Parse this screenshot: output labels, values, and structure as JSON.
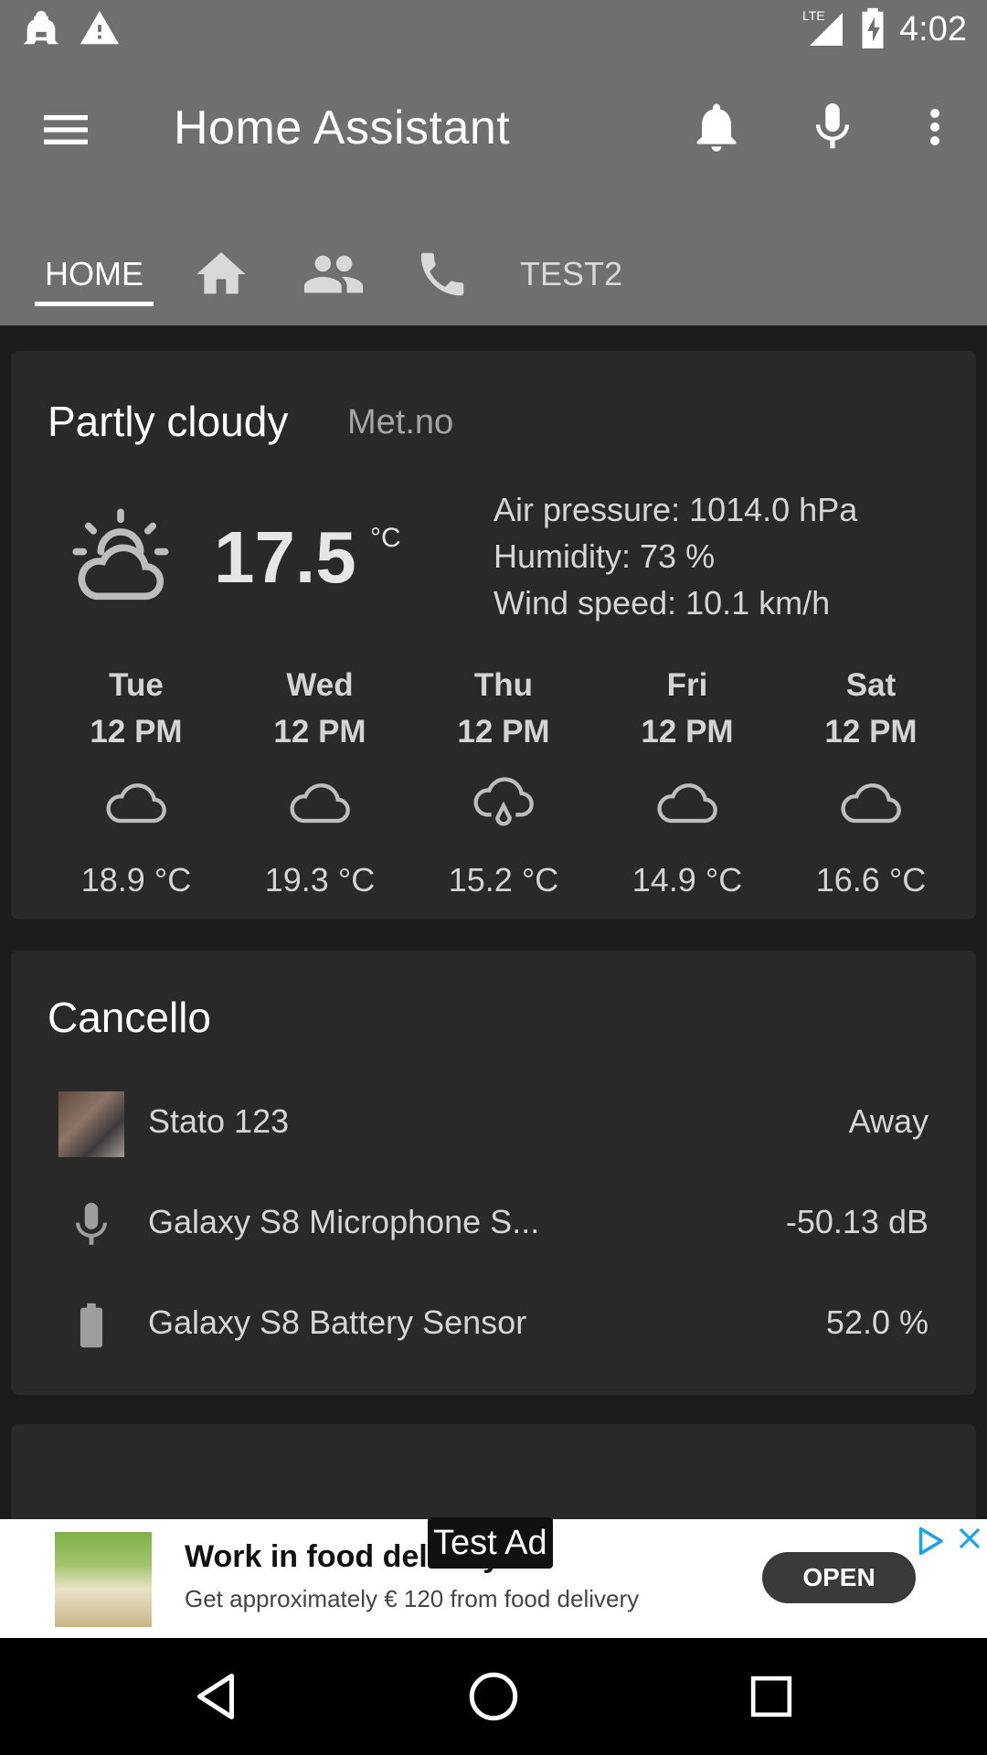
{
  "status_bar": {
    "time": "4:02",
    "network": "LTE",
    "icons": [
      "home-assistant-notification-icon",
      "warning-icon",
      "signal-icon",
      "battery-charging-icon"
    ]
  },
  "toolbar": {
    "title": "Home Assistant",
    "icons": [
      "menu-icon",
      "bell-icon",
      "microphone-icon",
      "more-vert-icon"
    ]
  },
  "tabs": [
    {
      "label": "HOME",
      "active": true
    },
    {
      "icon": "home-icon"
    },
    {
      "icon": "people-icon"
    },
    {
      "icon": "phone-icon"
    },
    {
      "label": "TEST2"
    }
  ],
  "weather": {
    "condition": "Partly cloudy",
    "source": "Met.no",
    "icon": "partly-cloudy-icon",
    "temperature": "17.5",
    "unit": "°C",
    "attributes": {
      "pressure": "Air pressure: 1014.0 hPa",
      "humidity": "Humidity: 73 %",
      "wind": "Wind speed: 10.1 km/h"
    },
    "forecast": [
      {
        "day": "Tue",
        "time": "12 PM",
        "icon": "cloud-icon",
        "temp": "18.9 °C"
      },
      {
        "day": "Wed",
        "time": "12 PM",
        "icon": "cloud-icon",
        "temp": "19.3 °C"
      },
      {
        "day": "Thu",
        "time": "12 PM",
        "icon": "rain-icon",
        "temp": "15.2 °C"
      },
      {
        "day": "Fri",
        "time": "12 PM",
        "icon": "cloud-icon",
        "temp": "14.9 °C"
      },
      {
        "day": "Sat",
        "time": "12 PM",
        "icon": "cloud-icon",
        "temp": "16.6 °C"
      }
    ]
  },
  "cancello": {
    "title": "Cancello",
    "rows": [
      {
        "icon": "avatar",
        "name": "Stato 123",
        "value": "Away"
      },
      {
        "icon": "microphone-icon",
        "name": "Galaxy S8 Microphone S...",
        "value": "-50.13 dB"
      },
      {
        "icon": "battery-icon",
        "name": "Galaxy S8 Battery Sensor",
        "value": "52.0 %"
      }
    ]
  },
  "ad": {
    "label": "Test Ad",
    "headline": "Work in food delivery",
    "subtext": "Get approximately € 120 from food delivery",
    "cta": "OPEN"
  },
  "colors": {
    "toolbar": "#6f6f6f",
    "background": "#1c1c1c",
    "card": "#292929"
  }
}
